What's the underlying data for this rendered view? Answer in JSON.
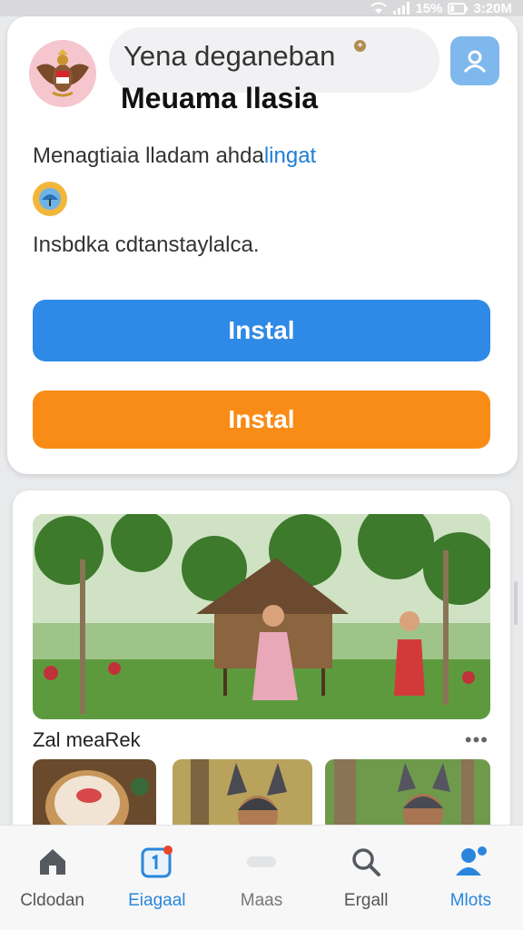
{
  "status_bar": {
    "battery": "15%",
    "time": "3:20M"
  },
  "header": {
    "search_title": "Yena deganeban",
    "search_badge": "+",
    "subtitle": "Meuama llasia"
  },
  "card": {
    "description_main": "Menagtiaia lladam ahda",
    "description_link": "lingat",
    "note": "Insbdka cdtanstaylalca.",
    "install_primary_label": "Instal",
    "install_secondary_label": "Instal"
  },
  "feed": {
    "section_title": "Zal meaRek",
    "more_label": "•••"
  },
  "bottom_nav": {
    "items": [
      {
        "label": "Cldodan",
        "icon": "home-icon"
      },
      {
        "label": "Eiagaal",
        "icon": "calendar-icon"
      },
      {
        "label": "Maas",
        "icon": "maps-icon"
      },
      {
        "label": "Ergall",
        "icon": "search-icon"
      },
      {
        "label": "Mlots",
        "icon": "profile-icon"
      }
    ],
    "active_index": 4
  },
  "colors": {
    "primary_blue": "#2f89e6",
    "accent_orange": "#f98c16",
    "link_blue": "#1f7fd6",
    "badge_red": "#e8452c"
  }
}
